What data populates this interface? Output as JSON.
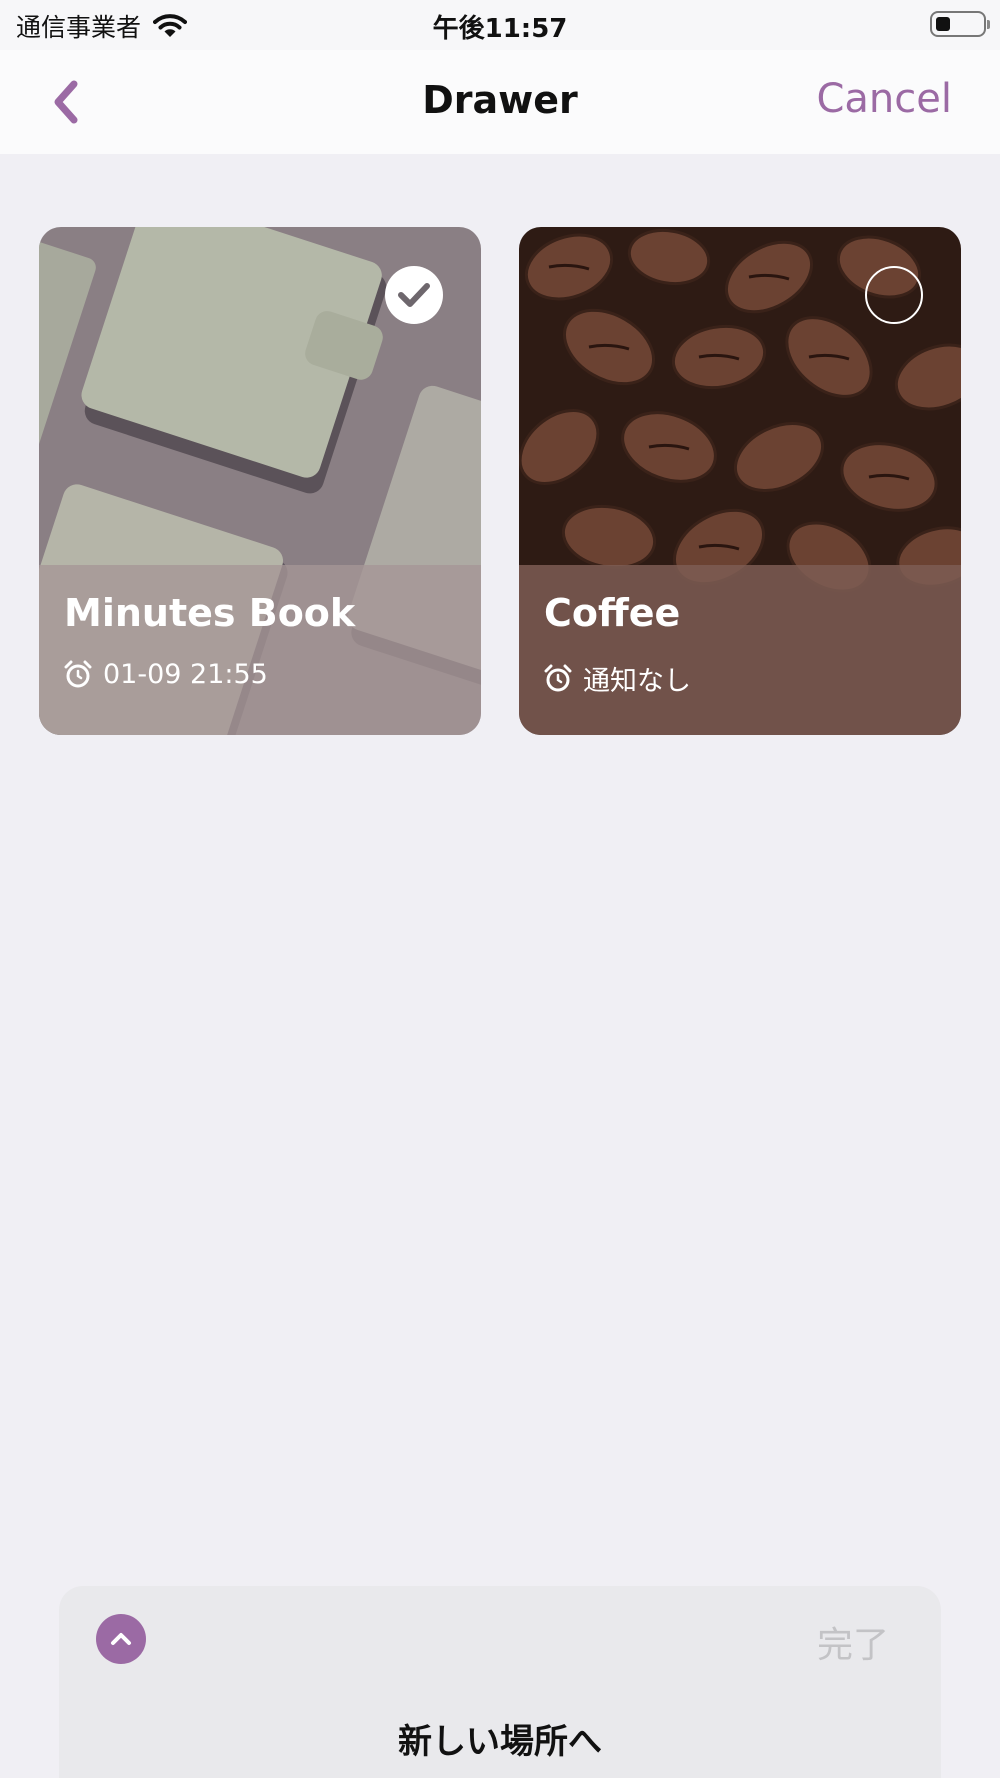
{
  "status_bar": {
    "carrier": "通信事業者",
    "time": "午後11:57"
  },
  "nav": {
    "title": "Drawer",
    "cancel_label": "Cancel",
    "accent_color": "#9b6aa4"
  },
  "cards": [
    {
      "title": "Minutes Book",
      "reminder": "01-09 21:55",
      "selected": true,
      "image": "notebooks-photo"
    },
    {
      "title": "Coffee",
      "reminder": "通知なし",
      "selected": false,
      "image": "coffee-beans-photo"
    }
  ],
  "bottom_sheet": {
    "done_label": "完了",
    "title": "新しい場所へ"
  }
}
